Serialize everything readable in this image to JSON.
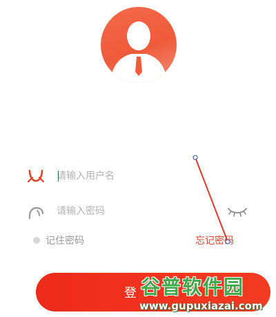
{
  "login": {
    "username_placeholder": "请输入用户名",
    "password_placeholder": "请输入密码",
    "remember_label": "记住密码",
    "forgot_label": "忘记密码",
    "login_label": "登"
  },
  "watermark": {
    "title": "谷普软件园",
    "url": "www.gupuxiazai.com"
  },
  "colors": {
    "accent": "#ee2a1a",
    "avatar": "#f46a4a",
    "forgot_link": "#e2422a"
  },
  "icons": {
    "user": "user-icon",
    "password": "lock-icon",
    "show_password": "eye-closed-icon"
  }
}
